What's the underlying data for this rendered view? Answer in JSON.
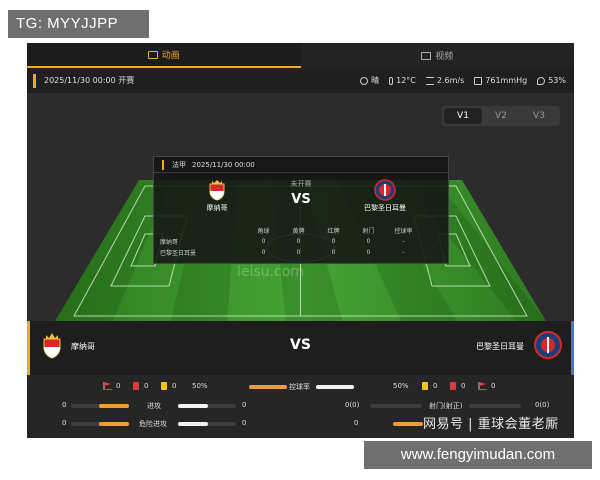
{
  "overlay_tag": "TG: MYYJJPP",
  "tabs": [
    {
      "label": "动画",
      "icon": "animation-icon",
      "active": true
    },
    {
      "label": "视频",
      "icon": "video-icon",
      "active": false
    }
  ],
  "match_info": {
    "datetime": "2025/11/30 00:00 开赛",
    "weather": {
      "condition": "晴",
      "temperature": "12°C",
      "wind": "2.6m/s",
      "pressure": "761mmHg",
      "humidity": "53%"
    }
  },
  "view_tabs": [
    {
      "label": "V1",
      "active": true
    },
    {
      "label": "V2",
      "active": false
    },
    {
      "label": "V3",
      "active": false
    }
  ],
  "popup": {
    "league": "法甲",
    "time": "2025/11/30 00:00",
    "status": "未开赛",
    "vs": "VS",
    "home": "摩纳哥",
    "away": "巴黎圣日耳曼",
    "columns": [
      "角球",
      "黄牌",
      "红牌",
      "射门",
      "控球率"
    ],
    "rows": [
      {
        "team": "摩纳哥",
        "values": [
          "0",
          "0",
          "0",
          "0",
          "-"
        ]
      },
      {
        "team": "巴黎圣日耳曼",
        "values": [
          "0",
          "0",
          "0",
          "0",
          "-"
        ]
      }
    ]
  },
  "pitch_watermark": "leisu.com",
  "scoreboard": {
    "home": "摩纳哥",
    "away": "巴黎圣日耳曼",
    "vs": "VS"
  },
  "stats": {
    "home_corners": "0",
    "home_red": "0",
    "home_yellow": "0",
    "away_yellow": "0",
    "away_red": "0",
    "away_corners": "0",
    "possession_label": "控球率",
    "home_possession": "50%",
    "away_possession": "50%",
    "home_possession_value": 50,
    "attack_label": "进攻",
    "home_attack": "0",
    "away_attack": "0",
    "danger_label": "危险进攻",
    "home_danger": "0",
    "away_danger": "0",
    "shots_label": "射门(射正)",
    "home_shots": "0(0)",
    "away_shots": "0(0)",
    "home_shots_right": "0"
  },
  "watermark": "网易号 | 重球会董老厮",
  "site_url": "www.fengyimudan.com",
  "colors": {
    "accent": "#f6a623",
    "pitch_light": "#3f9a2f",
    "pitch_dark": "#2d7a1f",
    "away_edge": "#2f7fd9"
  }
}
